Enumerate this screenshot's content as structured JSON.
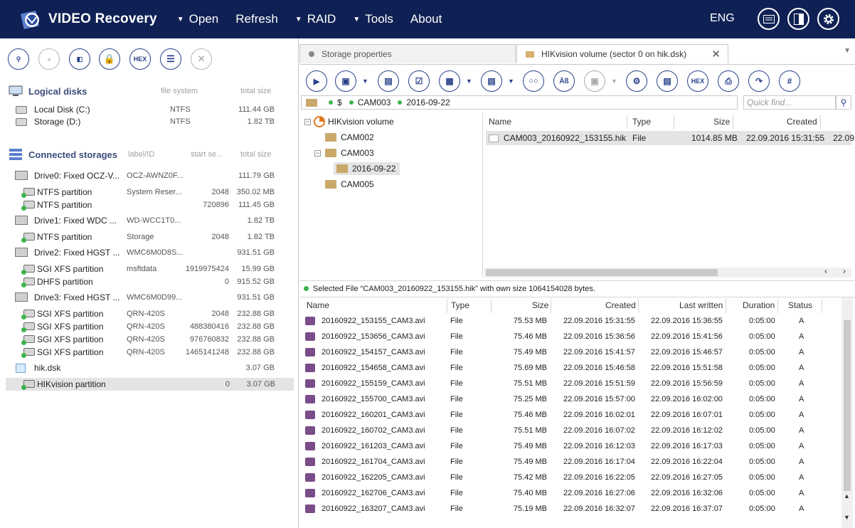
{
  "header": {
    "app_title": "VIDEO Recovery",
    "menu": [
      {
        "label": "Open",
        "dropdown": true
      },
      {
        "label": "Refresh",
        "dropdown": false
      },
      {
        "label": "RAID",
        "dropdown": true
      },
      {
        "label": "Tools",
        "dropdown": true
      },
      {
        "label": "About",
        "dropdown": false
      }
    ],
    "lang": "ENG",
    "colors": {
      "bg": "#0f2154",
      "accent": "#29418b"
    }
  },
  "left_toolbar": {
    "hex_label": "HEX"
  },
  "logical_disks": {
    "title": "Logical disks",
    "col_fs": "file system",
    "col_size": "total size",
    "items": [
      {
        "name": "Local Disk (C:)",
        "fs": "NTFS",
        "size": "111.44 GB"
      },
      {
        "name": "Storage (D:)",
        "fs": "NTFS",
        "size": "1.82 TB"
      }
    ]
  },
  "storages": {
    "title": "Connected storages",
    "col_label": "label/ID",
    "col_start": "start se...",
    "col_size": "total size",
    "rows": [
      {
        "kind": "drive",
        "name": "Drive0: Fixed OCZ-V...",
        "label": "OCZ-AWNZ0F...",
        "start": "",
        "size": "111.79 GB"
      },
      {
        "kind": "part",
        "name": "NTFS partition",
        "label": "System Reser...",
        "start": "2048",
        "size": "350.02 MB"
      },
      {
        "kind": "part",
        "name": "NTFS partition",
        "label": "",
        "start": "720896",
        "size": "111.45 GB"
      },
      {
        "kind": "drive",
        "name": "Drive1: Fixed WDC ...",
        "label": "WD-WCC1T0...",
        "start": "",
        "size": "1.82 TB"
      },
      {
        "kind": "part",
        "name": "NTFS partition",
        "label": "Storage",
        "start": "2048",
        "size": "1.82 TB"
      },
      {
        "kind": "drive",
        "name": "Drive2: Fixed HGST ...",
        "label": "WMC6M0D8S...",
        "start": "",
        "size": "931.51 GB"
      },
      {
        "kind": "part",
        "name": "SGI XFS partition",
        "label": "msftdata",
        "start": "1919975424",
        "size": "15.99 GB"
      },
      {
        "kind": "part",
        "name": "DHFS partition",
        "label": "",
        "start": "0",
        "size": "915.52 GB"
      },
      {
        "kind": "drive",
        "name": "Drive3: Fixed HGST ...",
        "label": "WMC6M0D99...",
        "start": "",
        "size": "931.51 GB"
      },
      {
        "kind": "part",
        "name": "SGI XFS partition",
        "label": "QRN-420S",
        "start": "2048",
        "size": "232.88 GB"
      },
      {
        "kind": "part",
        "name": "SGI XFS partition",
        "label": "QRN-420S",
        "start": "488380416",
        "size": "232.88 GB"
      },
      {
        "kind": "part",
        "name": "SGI XFS partition",
        "label": "QRN-420S",
        "start": "976760832",
        "size": "232.88 GB"
      },
      {
        "kind": "part",
        "name": "SGI XFS partition",
        "label": "QRN-420S",
        "start": "1465141248",
        "size": "232.88 GB"
      },
      {
        "kind": "image",
        "name": "hik.dsk",
        "label": "",
        "start": "",
        "size": "3.07 GB"
      },
      {
        "kind": "part",
        "name": "HIKvision partition",
        "label": "",
        "start": "0",
        "size": "3.07 GB",
        "selected": true
      }
    ]
  },
  "tabs": [
    {
      "label": "Storage properties"
    },
    {
      "label": "HIKvision volume (sector 0 on hik.dsk)"
    }
  ],
  "right_toolbar": {
    "hex_label": "HEX"
  },
  "path": {
    "root": "$",
    "segments": [
      "CAM003",
      "2016-09-22"
    ]
  },
  "quick_find": {
    "placeholder": "Quick find..."
  },
  "tree": [
    {
      "label": "HIKvision volume"
    },
    {
      "label": "CAM002"
    },
    {
      "label": "CAM003"
    },
    {
      "label": "2016-09-22"
    },
    {
      "label": "CAM005"
    }
  ],
  "file_list": {
    "headers": [
      "Name",
      "Type",
      "Size",
      "Created"
    ],
    "row": {
      "name": "CAM003_20160922_153155.hik",
      "type": "File",
      "size": "1014.85 MB",
      "created": "22.09.2016 15:31:55",
      "next": "22.09"
    }
  },
  "status": {
    "text": "Selected File “CAM003_20160922_153155.hik” with own size 1064154028 bytes."
  },
  "table": {
    "headers": [
      "Name",
      "Type",
      "Size",
      "Created",
      "Last written",
      "Duration",
      "Status"
    ],
    "rows": [
      [
        "20160922_153155_CAM3.avi",
        "File",
        "75.53 MB",
        "22.09.2016 15:31:55",
        "22.09.2016 15:36:55",
        "0:05:00",
        "A"
      ],
      [
        "20160922_153656_CAM3.avi",
        "File",
        "75.46 MB",
        "22.09.2016 15:36:56",
        "22.09.2016 15:41:56",
        "0:05:00",
        "A"
      ],
      [
        "20160922_154157_CAM3.avi",
        "File",
        "75.49 MB",
        "22.09.2016 15:41:57",
        "22.09.2016 15:46:57",
        "0:05:00",
        "A"
      ],
      [
        "20160922_154658_CAM3.avi",
        "File",
        "75.69 MB",
        "22.09.2016 15:46:58",
        "22.09.2016 15:51:58",
        "0:05:00",
        "A"
      ],
      [
        "20160922_155159_CAM3.avi",
        "File",
        "75.51 MB",
        "22.09.2016 15:51:59",
        "22.09.2016 15:56:59",
        "0:05:00",
        "A"
      ],
      [
        "20160922_155700_CAM3.avi",
        "File",
        "75.25 MB",
        "22.09.2016 15:57:00",
        "22.09.2016 16:02:00",
        "0:05:00",
        "A"
      ],
      [
        "20160922_160201_CAM3.avi",
        "File",
        "75.46 MB",
        "22.09.2016 16:02:01",
        "22.09.2016 16:07:01",
        "0:05:00",
        "A"
      ],
      [
        "20160922_160702_CAM3.avi",
        "File",
        "75.51 MB",
        "22.09.2016 16:07:02",
        "22.09.2016 16:12:02",
        "0:05:00",
        "A"
      ],
      [
        "20160922_161203_CAM3.avi",
        "File",
        "75.49 MB",
        "22.09.2016 16:12:03",
        "22.09.2016 16:17:03",
        "0:05:00",
        "A"
      ],
      [
        "20160922_161704_CAM3.avi",
        "File",
        "75.49 MB",
        "22.09.2016 16:17:04",
        "22.09.2016 16:22:04",
        "0:05:00",
        "A"
      ],
      [
        "20160922_162205_CAM3.avi",
        "File",
        "75.42 MB",
        "22.09.2016 16:22:05",
        "22.09.2016 16:27:05",
        "0:05:00",
        "A"
      ],
      [
        "20160922_162706_CAM3.avi",
        "File",
        "75.40 MB",
        "22.09.2016 16:27:06",
        "22.09.2016 16:32:06",
        "0:05:00",
        "A"
      ],
      [
        "20160922_163207_CAM3.avi",
        "File",
        "75.19 MB",
        "22.09.2016 16:32:07",
        "22.09.2016 16:37:07",
        "0:05:00",
        "A"
      ]
    ]
  }
}
